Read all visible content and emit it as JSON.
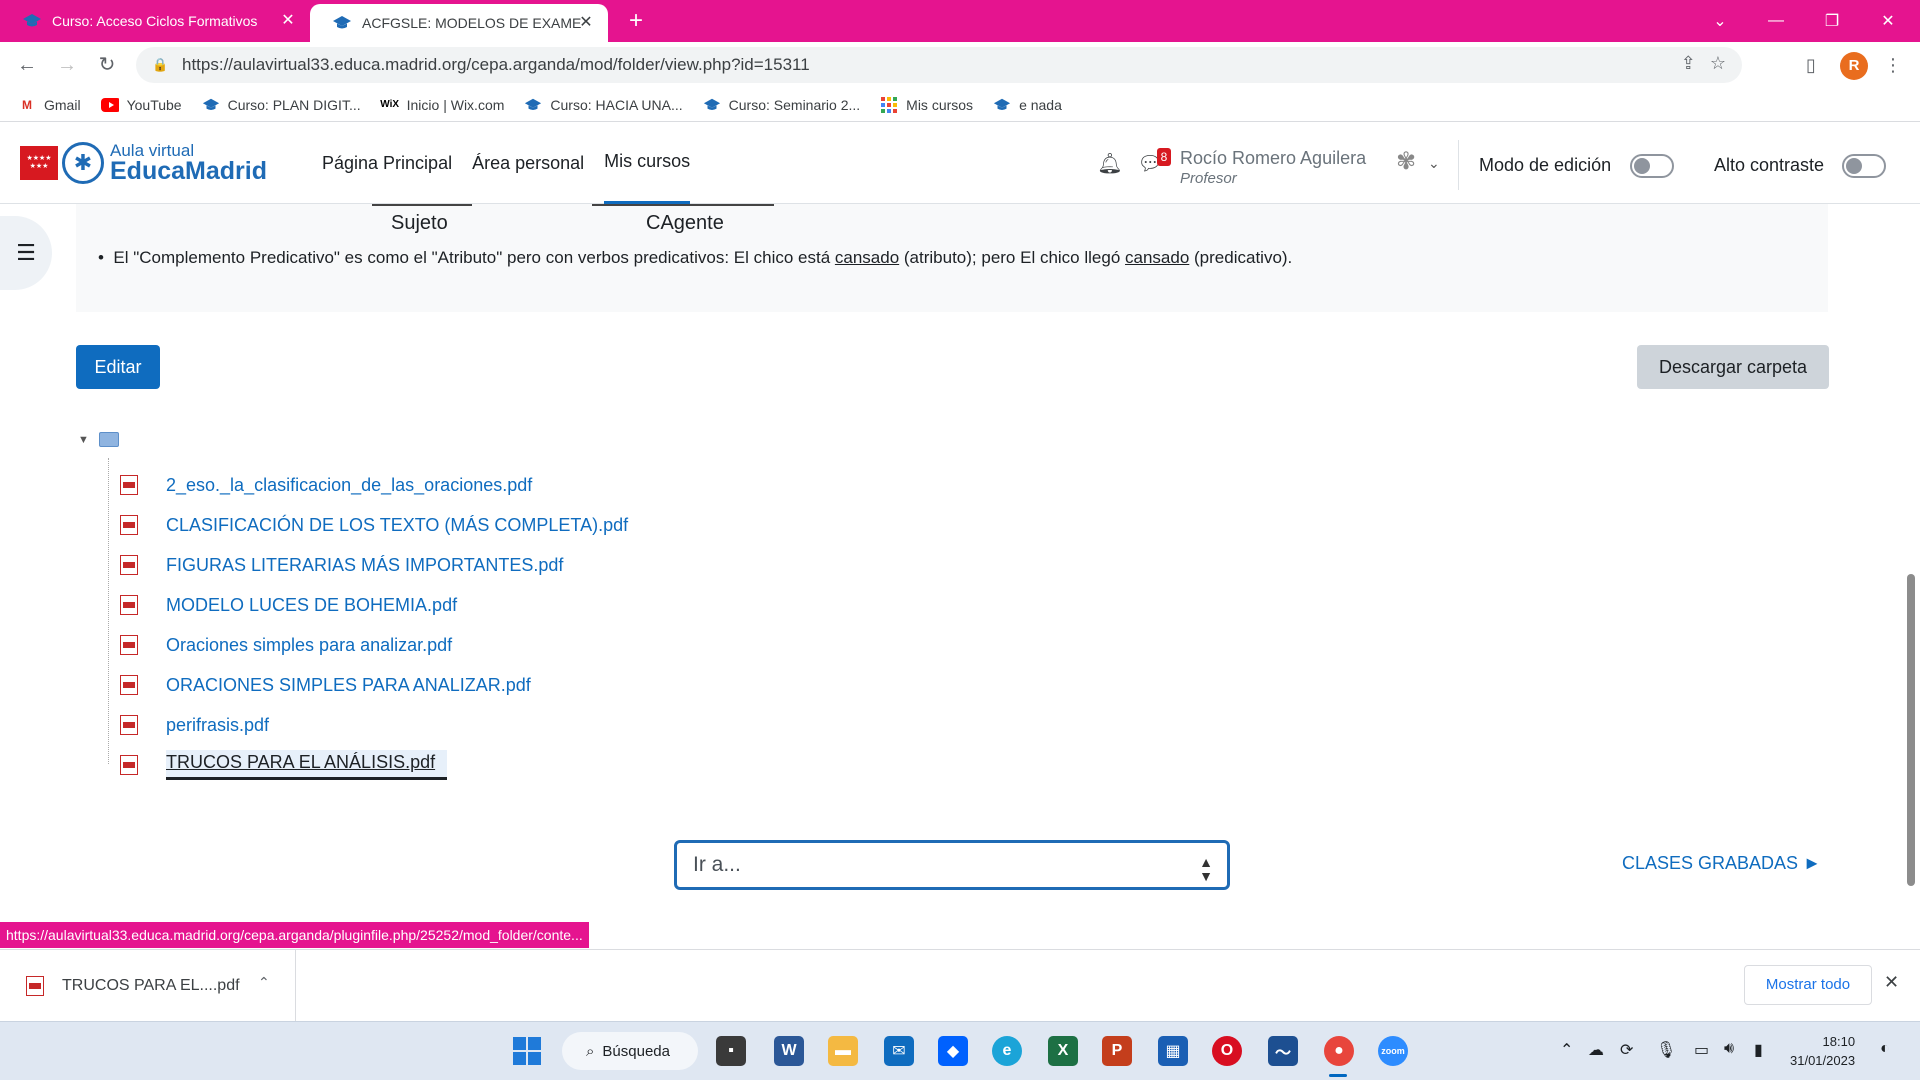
{
  "browser": {
    "tabs": [
      {
        "title": "Curso: Acceso Ciclos Formativos",
        "active": false
      },
      {
        "title": "ACFGSLE: MODELOS DE EXAMEN",
        "active": true
      }
    ],
    "url": "https://aulavirtual33.educa.madrid.org/cepa.arganda/mod/folder/view.php?id=15311",
    "profile_initial": "R",
    "accent_color": "#e5148f"
  },
  "bookmarks": [
    {
      "label": "Gmail",
      "icon": "gmail-icon"
    },
    {
      "label": "YouTube",
      "icon": "youtube-icon"
    },
    {
      "label": "Curso: PLAN DIGIT...",
      "icon": "course-icon"
    },
    {
      "label": "Inicio | Wix.com",
      "icon": "wix-icon"
    },
    {
      "label": "Curso: HACIA UNA...",
      "icon": "course-icon"
    },
    {
      "label": "Curso: Seminario 2...",
      "icon": "course-icon"
    },
    {
      "label": "Mis cursos",
      "icon": "apps-icon"
    },
    {
      "label": "e nada",
      "icon": "course-icon"
    }
  ],
  "site": {
    "logo_line1": "Aula virtual",
    "logo_line2": "EducaMadrid",
    "nav": [
      "Página Principal",
      "Área personal",
      "Mis cursos"
    ],
    "messages_count": "8",
    "user_name": "Rocío Romero Aguilera",
    "user_role": "Profesor",
    "edit_mode_label": "Modo de edición",
    "contrast_label": "Alto contraste"
  },
  "content": {
    "table_labels": [
      "Sujeto",
      "CAgente"
    ],
    "bullet_before": "El \"Complemento Predicativo\" es  como el \"Atributo\" pero con verbos predicativos: El chico está ",
    "bullet_u1": "cansado",
    "bullet_mid": " (atributo); pero El chico llegó ",
    "bullet_u2": "cansado",
    "bullet_after": " (predicativo).",
    "edit_button": "Editar",
    "download_button": "Descargar carpeta",
    "files": [
      "2_eso._la_clasificacion_de_las_oraciones.pdf",
      "CLASIFICACIÓN DE LOS TEXTO (MÁS COMPLETA).pdf",
      "FIGURAS LITERARIAS MÁS IMPORTANTES.pdf",
      "MODELO LUCES DE BOHEMIA.pdf",
      "Oraciones simples para analizar.pdf",
      "ORACIONES SIMPLES PARA ANALIZAR.pdf",
      "perifrasis.pdf",
      "TRUCOS PARA EL ANÁLISIS.pdf"
    ],
    "selected_file_index": 7,
    "goto_placeholder": "Ir a...",
    "next_link": "CLASES GRABADAS ►"
  },
  "status_url": "https://aulavirtual33.educa.madrid.org/cepa.arganda/pluginfile.php/25252/mod_folder/conte...",
  "download_shelf": {
    "item_name": "TRUCOS PARA EL....pdf",
    "show_all": "Mostrar todo"
  },
  "taskbar": {
    "search_label": "Búsqueda",
    "time": "18:10",
    "date": "31/01/2023"
  }
}
